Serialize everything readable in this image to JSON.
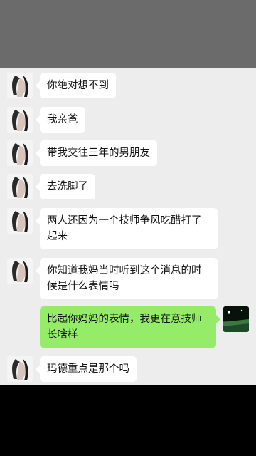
{
  "chat": {
    "messages": [
      {
        "side": "left",
        "text": "你绝对想不到",
        "avatar": "girl-avatar-icon"
      },
      {
        "side": "left",
        "text": "我亲爸",
        "avatar": "girl-avatar-icon"
      },
      {
        "side": "left",
        "text": "带我交往三年的男朋友",
        "avatar": "girl-avatar-icon"
      },
      {
        "side": "left",
        "text": "去洗脚了",
        "avatar": "girl-avatar-icon"
      },
      {
        "side": "left",
        "text": "两人还因为一个技师争风吃醋打了起来",
        "avatar": "girl-avatar-icon"
      },
      {
        "side": "left",
        "text": "你知道我妈当时听到这个消息的时候是什么表情吗",
        "avatar": "girl-avatar-icon"
      },
      {
        "side": "right",
        "text": "比起你妈妈的表情，我更在意技师长啥样",
        "avatar": "night-field-avatar-icon"
      },
      {
        "side": "left",
        "text": "玛德重点是那个吗",
        "avatar": "girl-avatar-icon"
      }
    ]
  },
  "colors": {
    "chat_background": "#ededed",
    "incoming_bubble": "#ffffff",
    "outgoing_bubble": "#95ec69",
    "top_bar": "#6b6b6b"
  }
}
